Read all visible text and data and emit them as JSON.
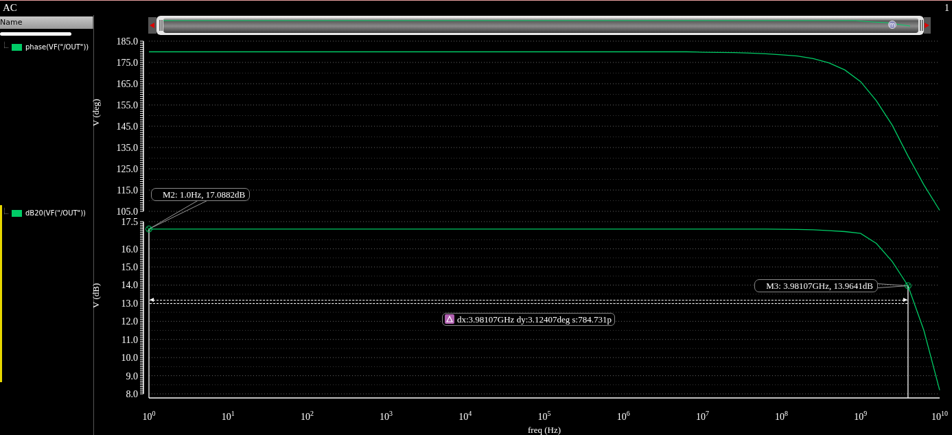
{
  "window": {
    "title": "AC",
    "number": "1"
  },
  "legend": {
    "header": "Name"
  },
  "overview": {
    "marker_label": "m"
  },
  "charts": [
    {
      "selected": false,
      "chart_data": {
        "type": "line",
        "ylabel": "V (deg)",
        "grid": true,
        "ylim": [
          105,
          185
        ],
        "categories": [
          null,
          null,
          null,
          null,
          null,
          null,
          null,
          null,
          null,
          null,
          null,
          null,
          null,
          null,
          null,
          null,
          null,
          null,
          null,
          null,
          null,
          null,
          null,
          null,
          null,
          null,
          null,
          null,
          null,
          null,
          null,
          null,
          null,
          null,
          null,
          null,
          null,
          null,
          null,
          null,
          null,
          null,
          null,
          null,
          null,
          null,
          null,
          null,
          null,
          null,
          null
        ],
        "series": [
          {
            "name": "phase(VF(\"/OUT\"))",
            "color": "#00cc66",
            "values": [
              180,
              180,
              180,
              180,
              180,
              180,
              180,
              180,
              180,
              180,
              180,
              180,
              180,
              180,
              180,
              180,
              180,
              180,
              180,
              180,
              180,
              180,
              180,
              180,
              180,
              180,
              180,
              180,
              180,
              180,
              180,
              180,
              180,
              180,
              180,
              179.8,
              179.7,
              179.6,
              179.4,
              179.1,
              178.6,
              178.0,
              176.8,
              174.8,
              171.5,
              166,
              157,
              145.5,
              131,
              117.5,
              105.5
            ]
          }
        ],
        "yticks": [
          {
            "value": 105,
            "label": "105.0"
          },
          {
            "value": 115,
            "label": "115.0"
          },
          {
            "value": 125,
            "label": "125.0"
          },
          {
            "value": 135,
            "label": "135.0"
          },
          {
            "value": 145,
            "label": "145.0"
          },
          {
            "value": 155,
            "label": "155.0"
          },
          {
            "value": 165,
            "label": "165.0"
          },
          {
            "value": 175,
            "label": "175.0"
          },
          {
            "value": 185,
            "label": "185.0"
          }
        ]
      }
    },
    {
      "selected": true,
      "chart_data": {
        "type": "line",
        "ylabel": "V (dB)",
        "xlabel": "freq (Hz)",
        "grid": true,
        "ylim": [
          8,
          17.5
        ],
        "categories": [
          "10$^{0}$",
          null,
          null,
          null,
          null,
          "10$^{1}$",
          null,
          null,
          null,
          null,
          "10$^{2}$",
          null,
          null,
          null,
          null,
          "10$^{3}$",
          null,
          null,
          null,
          null,
          "10$^{4}$",
          null,
          null,
          null,
          null,
          "10$^{5}$",
          null,
          null,
          null,
          null,
          "10$^{6}$",
          null,
          null,
          null,
          null,
          "10$^{7}$",
          null,
          null,
          null,
          null,
          "10$^{8}$",
          null,
          null,
          null,
          null,
          "10$^{9}$",
          null,
          null,
          null,
          null,
          "10$^{10}$"
        ],
        "series": [
          {
            "name": "dB20(VF(\"/OUT\"))",
            "color": "#00cc66",
            "values": [
              17.09,
              17.09,
              17.09,
              17.09,
              17.09,
              17.09,
              17.09,
              17.09,
              17.09,
              17.09,
              17.09,
              17.09,
              17.09,
              17.09,
              17.09,
              17.09,
              17.09,
              17.09,
              17.09,
              17.09,
              17.09,
              17.09,
              17.09,
              17.09,
              17.09,
              17.09,
              17.09,
              17.09,
              17.09,
              17.09,
              17.09,
              17.09,
              17.09,
              17.09,
              17.09,
              17.09,
              17.09,
              17.09,
              17.09,
              17.09,
              17.08,
              17.07,
              17.05,
              17.0,
              16.95,
              16.85,
              16.3,
              15.3,
              13.96,
              11.5,
              8.2
            ]
          }
        ],
        "yticks": [
          {
            "value": 8,
            "label": "8.0"
          },
          {
            "value": 9,
            "label": "9.0"
          },
          {
            "value": 10,
            "label": "10.0"
          },
          {
            "value": 11,
            "label": "11.0"
          },
          {
            "value": 12,
            "label": "12.0"
          },
          {
            "value": 13,
            "label": "13.0"
          },
          {
            "value": 14,
            "label": "14.0"
          },
          {
            "value": 15,
            "label": "15.0"
          },
          {
            "value": 16,
            "label": "16.0"
          },
          {
            "value": 17.5,
            "label": "17.5"
          }
        ],
        "annotations": [
          {
            "x": "10$^{0}$",
            "y": 17.09,
            "text": "M2: 1.0Hz, 17.0882dB"
          },
          "M3: 3.98107GHz, 13.9641dB",
          "dx:3.98107GHz dy:3.12407deg s:784.731p"
        ]
      }
    }
  ]
}
